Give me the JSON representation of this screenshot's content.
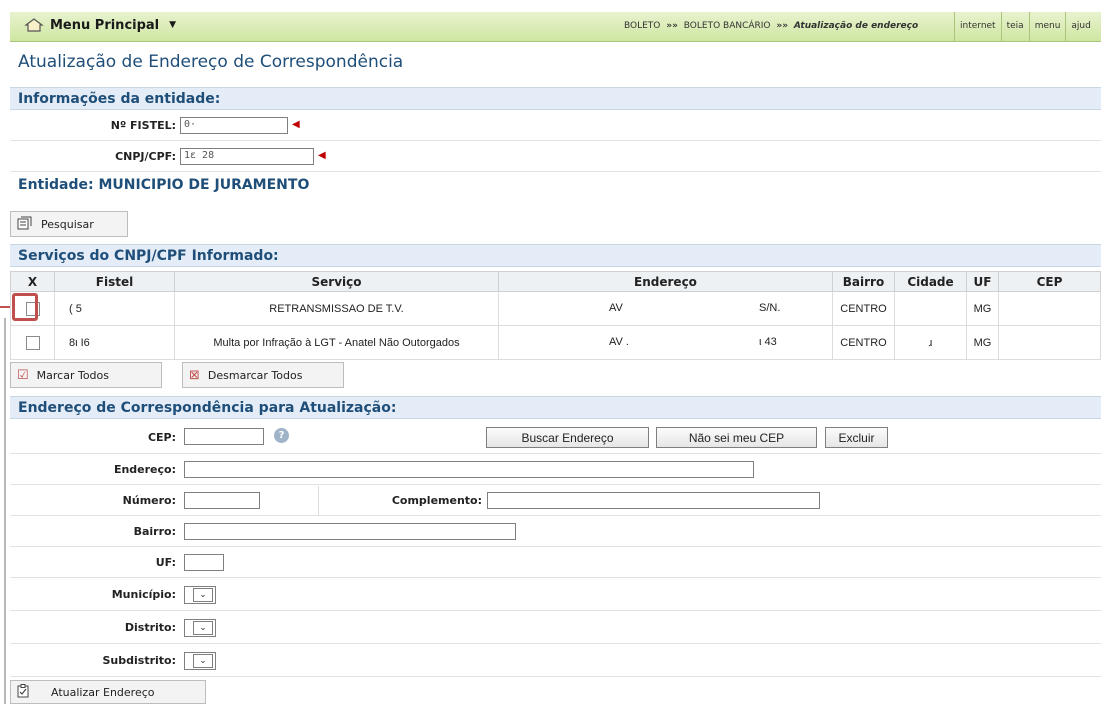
{
  "topbar": {
    "menu_label": "Menu Principal",
    "breadcrumb": [
      "BOLETO",
      "BOLETO BANCÁRIO",
      "Atualização de endereço"
    ],
    "breadcrumb_sep": "»»",
    "links": [
      "internet",
      "teia",
      "menu",
      "ajud"
    ]
  },
  "page_title": "Atualização de Endereço de Correspondência",
  "entity_info": {
    "heading": "Informações da entidade:",
    "fistel_label": "Nº FISTEL:",
    "fistel_value": "0·",
    "cnpj_label": "CNPJ/CPF:",
    "cnpj_value": "1ε                 28"
  },
  "entity": {
    "heading": "Entidade: MUNICIPIO DE JURAMENTO",
    "search_button": "Pesquisar"
  },
  "services": {
    "heading": "Serviços do CNPJ/CPF Informado:",
    "columns": [
      "X",
      "Fistel",
      "Serviço",
      "Endereço",
      "Bairro",
      "Cidade",
      "UF",
      "CEP"
    ],
    "rows": [
      {
        "fistel": "(          5",
        "servico": "RETRANSMISSAO DE T.V.",
        "endereco_a": "AV",
        "endereco_b": "S/N.",
        "bairro": "CENTRO",
        "cidade": "",
        "uf": "MG",
        "cep": ""
      },
      {
        "fistel": "8ι          Ι6",
        "servico": "Multa por Infração à LGT - Anatel Não Outorgados",
        "endereco_a": "AV .",
        "endereco_b": "ι 43",
        "bairro": "CENTRO",
        "cidade": "ɹ",
        "uf": "MG",
        "cep": ""
      }
    ],
    "mark_all": "Marcar Todos",
    "unmark_all": "Desmarcar Todos"
  },
  "address": {
    "heading": "Endereço de Correspondência para Atualização:",
    "cep_label": "CEP:",
    "search_address": "Buscar Endereço",
    "unknown_cep": "Não sei meu CEP",
    "delete": "Excluir",
    "endereco_label": "Endereço:",
    "numero_label": "Número:",
    "complemento_label": "Complemento:",
    "bairro_label": "Bairro:",
    "uf_label": "UF:",
    "municipio_label": "Município:",
    "distrito_label": "Distrito:",
    "subdistrito_label": "Subdistrito:",
    "update_button": "Atualizar Endereço"
  },
  "colors": {
    "title": "#1f4e79",
    "topbar": "#cfe6a2",
    "section": "#e4edf7",
    "highlight": "#c0504d",
    "required": "#c00000"
  }
}
